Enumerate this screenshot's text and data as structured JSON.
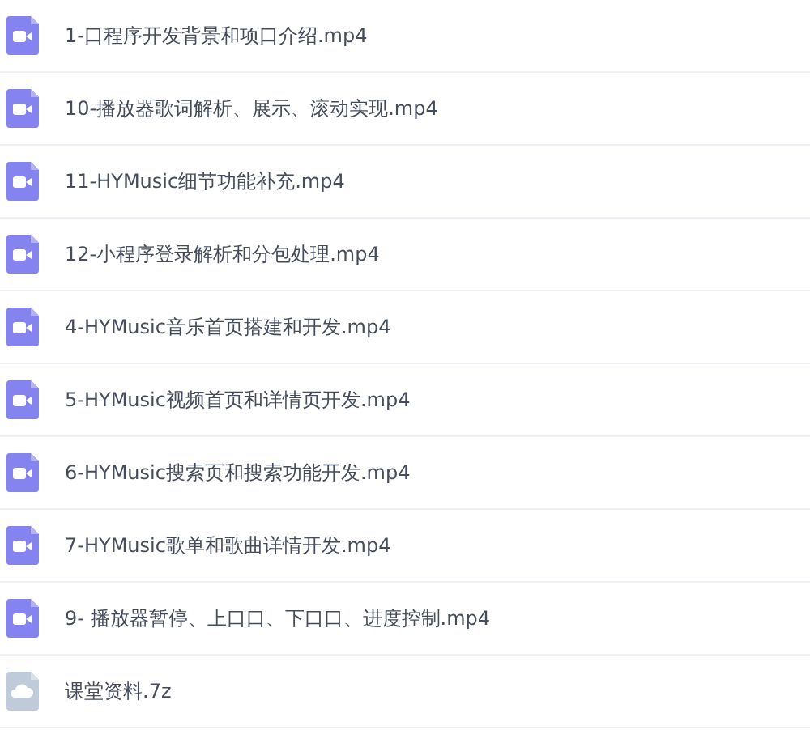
{
  "files": [
    {
      "name": "1-口程序开发背景和项口介绍.mp4",
      "kind": "video"
    },
    {
      "name": "10-播放器歌词解析、展示、滚动实现.mp4",
      "kind": "video"
    },
    {
      "name": "11-HYMusic细节功能补充.mp4",
      "kind": "video"
    },
    {
      "name": "12-小程序登录解析和分包处理.mp4",
      "kind": "video"
    },
    {
      "name": "4-HYMusic音乐首页搭建和开发.mp4",
      "kind": "video"
    },
    {
      "name": "5-HYMusic视频首页和详情页开发.mp4",
      "kind": "video"
    },
    {
      "name": "6-HYMusic搜索页和搜索功能开发.mp4",
      "kind": "video"
    },
    {
      "name": "7-HYMusic歌单和歌曲详情开发.mp4",
      "kind": "video"
    },
    {
      "name": "9- 播放器暂停、上口口、下口口、进度控制.mp4",
      "kind": "video"
    },
    {
      "name": "课堂资料.7z",
      "kind": "archive"
    }
  ]
}
